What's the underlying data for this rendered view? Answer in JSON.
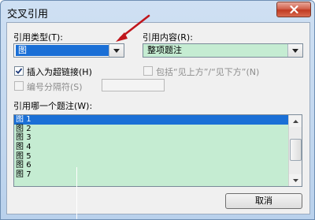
{
  "window": {
    "title": "交叉引用"
  },
  "icons": {
    "close": "close-icon",
    "dropdown": "chevron-down-icon",
    "check": "checkmark-icon",
    "scroll_up": "scroll-up-icon",
    "scroll_down": "scroll-down-icon"
  },
  "reference_type": {
    "label": "引用类型(T):",
    "value": "图"
  },
  "reference_content": {
    "label": "引用内容(R):",
    "value": "整项题注"
  },
  "options": {
    "insert_hyperlink": {
      "label": "插入为超链接(H)",
      "checked": true
    },
    "include_above_below": {
      "label": "包括“见上方”/“见下方”(N)",
      "checked": false,
      "enabled": false
    },
    "separate_numbers": {
      "label": "编号分隔符(S)",
      "checked": false,
      "enabled": false
    }
  },
  "list": {
    "label": "引用哪一个题注(W):",
    "items": [
      {
        "prefix": "图",
        "number": "1"
      },
      {
        "prefix": "图",
        "number": "2"
      },
      {
        "prefix": "图",
        "number": "3"
      },
      {
        "prefix": "图",
        "number": "4"
      },
      {
        "prefix": "图",
        "number": "5"
      },
      {
        "prefix": "图",
        "number": "6"
      },
      {
        "prefix": "图",
        "number": "7"
      }
    ],
    "selected_index": 0
  },
  "buttons": {
    "cancel": "取消"
  },
  "colors": {
    "selection": "#1a6fd6",
    "list_background": "#c5ecd2",
    "annotation_arrow": "#c0161c"
  }
}
